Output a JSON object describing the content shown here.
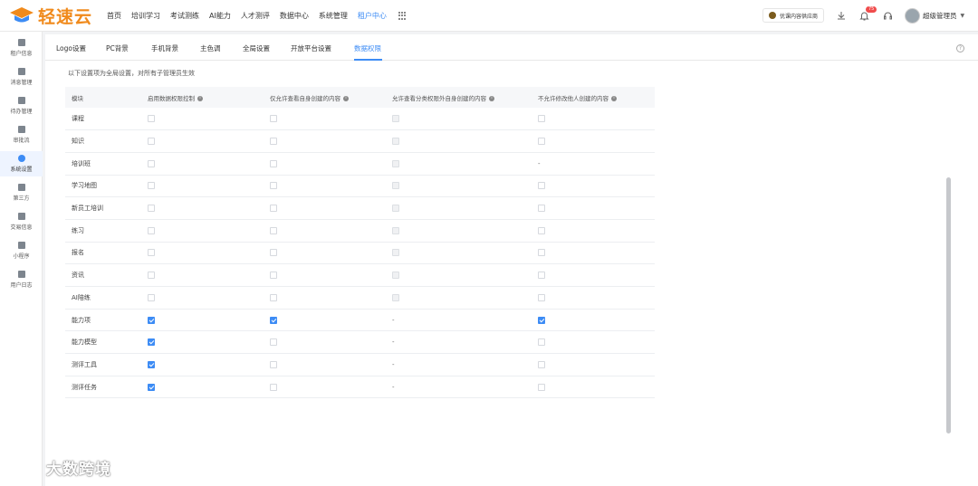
{
  "app": {
    "logo_text": "轻速云",
    "brand_color": "#f08a1c",
    "accent_color": "#3d8cf5"
  },
  "nav": {
    "items": [
      "首页",
      "培训学习",
      "考试测练",
      "AI能力",
      "人才测评",
      "数据中心",
      "系统管理",
      "租户中心"
    ],
    "active": "租户中心",
    "apps_icon": "grid-icon"
  },
  "header": {
    "partner_label": "优课内容供应商",
    "notification_count": "75",
    "user_name": "超级管理员"
  },
  "sidebar": {
    "items": [
      "租户信息",
      "消息管理",
      "待办管理",
      "审批流",
      "系统设置",
      "第三方",
      "交易信息",
      "小程序",
      "用户日志"
    ],
    "active": "系统设置"
  },
  "tabs": {
    "items": [
      "Logo设置",
      "PC背景",
      "手机背景",
      "主色调",
      "全局设置",
      "开放平台设置",
      "数据权限"
    ],
    "active": "数据权限"
  },
  "notice": "以下设置项为全局设置，对所有子管理员生效",
  "table": {
    "headers": [
      "模块",
      "启用数据权限控制",
      "仅允许查看自身创建的内容",
      "允许查看分类权限外自身创建的内容",
      "不允许修改他人创建的内容"
    ],
    "rows": [
      {
        "module": "课程",
        "cells": [
          "empty",
          "empty",
          "disabled",
          "empty"
        ]
      },
      {
        "module": "知识",
        "cells": [
          "empty",
          "empty",
          "disabled",
          "empty"
        ]
      },
      {
        "module": "培训班",
        "cells": [
          "empty",
          "empty",
          "disabled",
          "dash"
        ]
      },
      {
        "module": "学习地图",
        "cells": [
          "empty",
          "empty",
          "disabled",
          "empty"
        ]
      },
      {
        "module": "新员工培训",
        "cells": [
          "empty",
          "empty",
          "disabled",
          "empty"
        ]
      },
      {
        "module": "练习",
        "cells": [
          "empty",
          "empty",
          "disabled",
          "empty"
        ]
      },
      {
        "module": "报名",
        "cells": [
          "empty",
          "empty",
          "disabled",
          "empty"
        ]
      },
      {
        "module": "资讯",
        "cells": [
          "empty",
          "empty",
          "disabled",
          "empty"
        ]
      },
      {
        "module": "AI陪练",
        "cells": [
          "empty",
          "empty",
          "disabled",
          "empty"
        ]
      },
      {
        "module": "能力项",
        "cells": [
          "checked",
          "checked",
          "dash",
          "checked"
        ]
      },
      {
        "module": "能力模型",
        "cells": [
          "checked",
          "empty",
          "dash",
          "empty"
        ]
      },
      {
        "module": "测评工具",
        "cells": [
          "checked",
          "empty",
          "dash",
          "empty"
        ]
      },
      {
        "module": "测评任务",
        "cells": [
          "checked",
          "empty",
          "dash",
          "empty"
        ]
      }
    ]
  },
  "watermark": "大数跨境"
}
